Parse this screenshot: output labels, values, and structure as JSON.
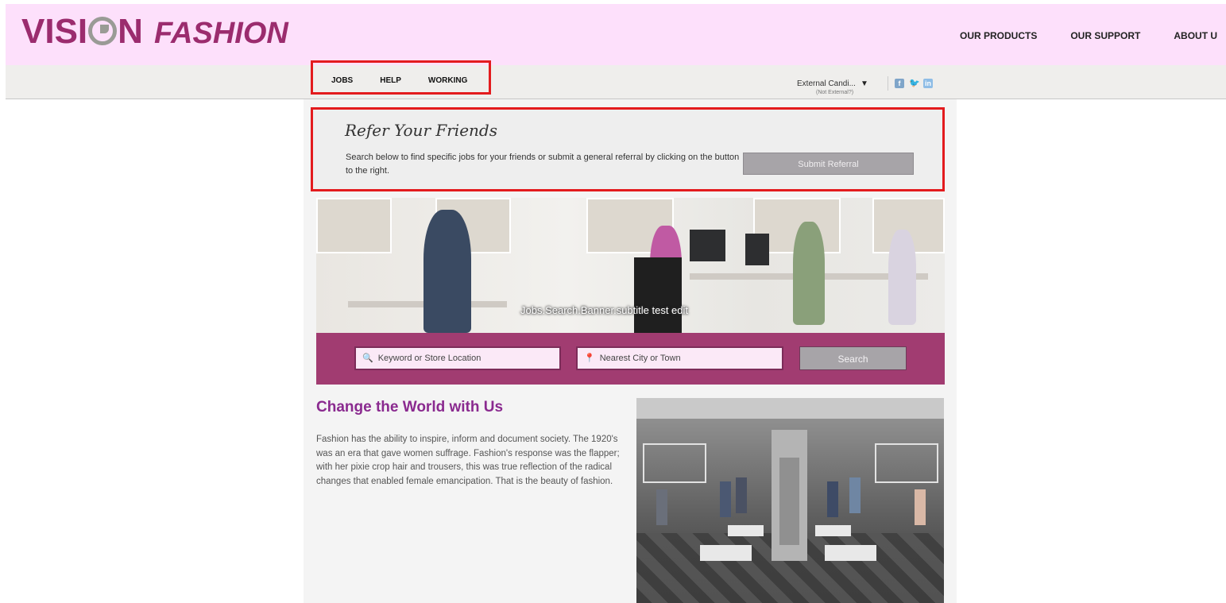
{
  "header": {
    "logo_part1": "VISI",
    "logo_part2": "N",
    "logo_part3": "FASHION",
    "nav": [
      "OUR PRODUCTS",
      "OUR SUPPORT",
      "ABOUT U"
    ]
  },
  "subnav": {
    "items": [
      "JOBS",
      "HELP",
      "WORKING"
    ],
    "user_name": "External Candi...",
    "user_sub": "(Not External?)",
    "social": [
      "facebook-icon",
      "twitter-icon",
      "linkedin-icon"
    ]
  },
  "refer": {
    "title": "Refer Your Friends",
    "text": "Search below to find specific jobs for your friends or submit a general referral by clicking on the button to the right.",
    "button": "Submit Referral"
  },
  "banner": {
    "caption": "Jobs.Search.Banner.subtitle test edit"
  },
  "search": {
    "keyword_placeholder": "Keyword or Store Location",
    "location_placeholder": "Nearest City or Town",
    "button": "Search"
  },
  "feature": {
    "title": "Change the World with Us",
    "body": "Fashion has the ability to inspire, inform and document society. The 1920's was an era that gave women suffrage. Fashion's response was the flapper; with her pixie crop hair and trousers, this was true reflection of the radical changes that enabled female emancipation. That is the beauty of fashion."
  },
  "colors": {
    "brand": "#9b2c6e",
    "header_bg": "#fde0fb",
    "search_band": "#a13c71",
    "highlight": "#e31b1e"
  }
}
